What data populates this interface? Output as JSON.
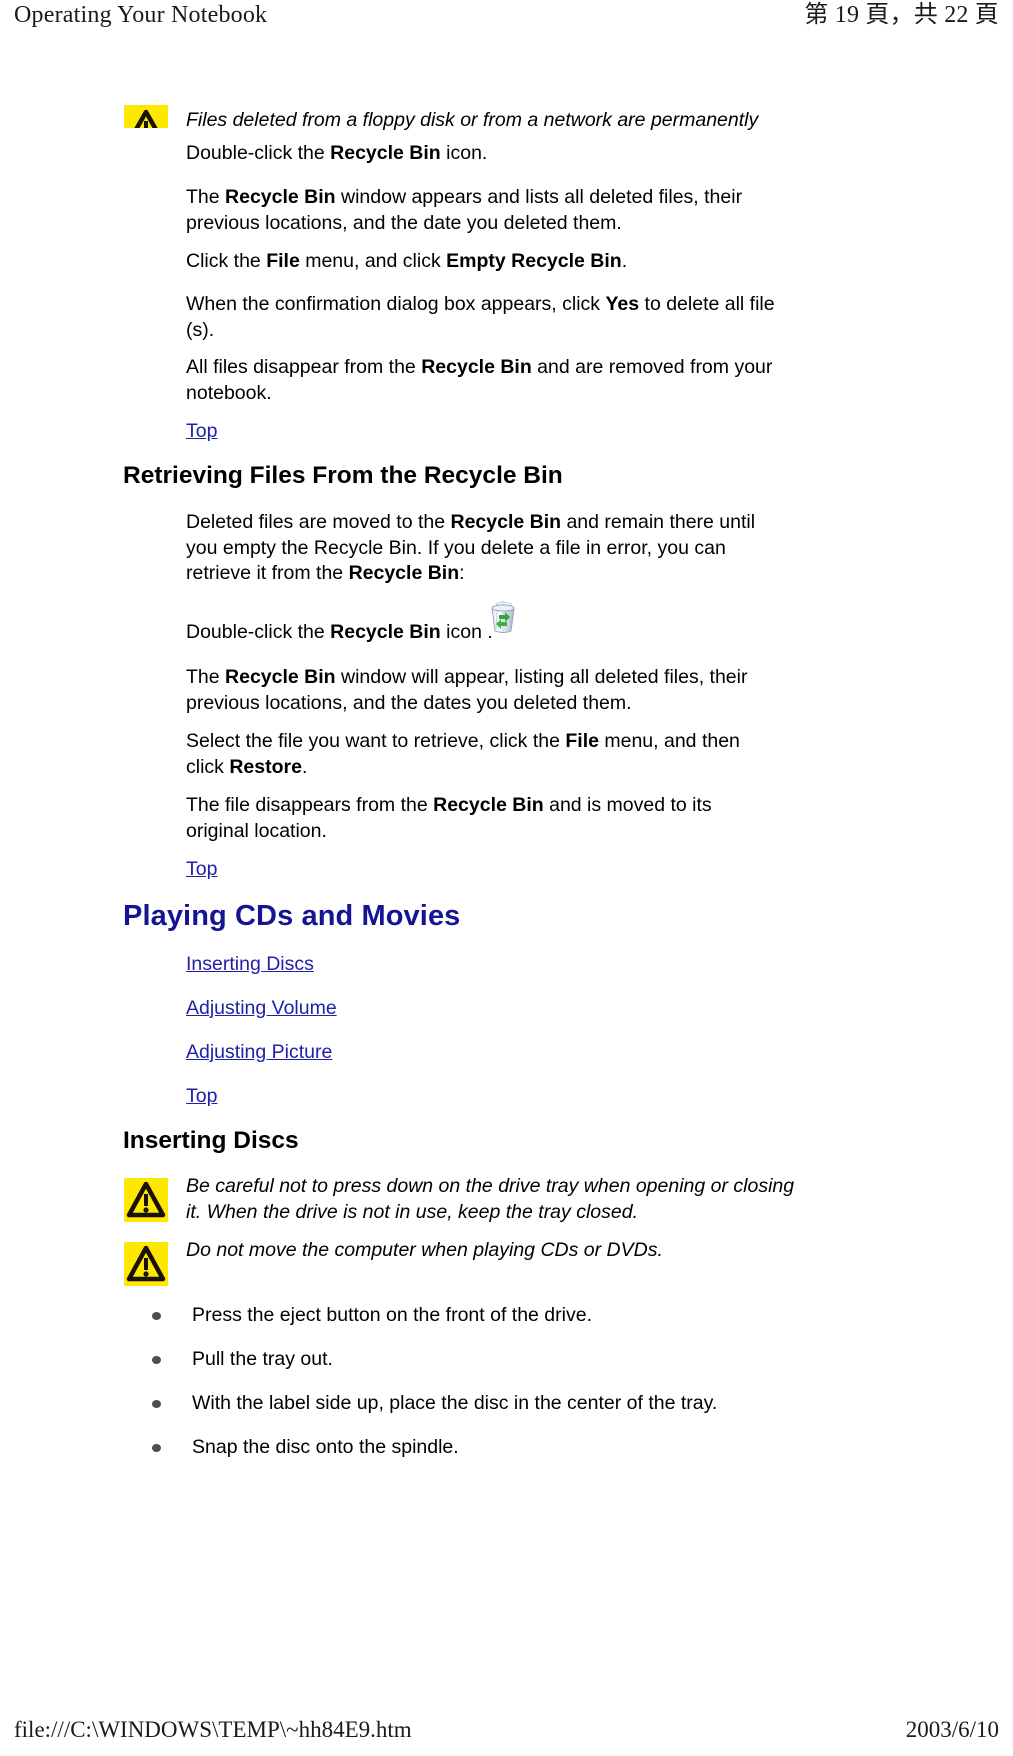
{
  "header": {
    "left_title": "Operating Your Notebook",
    "right_pagination": "第 19 頁，共 22 頁"
  },
  "footer": {
    "file_path": "file:///C:\\WINDOWS\\TEMP\\~hh84E9.htm",
    "date": "2003/6/10"
  },
  "notes": {
    "floppy_note": "Files deleted from a floppy disk or from a network are permanently",
    "tray_caution": "Be careful not to press down on the drive tray when opening or closing it. When the drive is not in use, keep the tray closed.",
    "move_caution": "Do not move the computer when playing CDs or DVDs."
  },
  "empty_recycle_steps": {
    "step1_pre": "Double-click the ",
    "step1_bold": "Recycle Bin",
    "step1_post": " icon.",
    "step2_pre": "The ",
    "step2_bold": "Recycle Bin",
    "step2_post": " window appears and lists all deleted files, their previous locations, and the date you deleted them.",
    "step3_pre": "Click the ",
    "step3_bold1": "File",
    "step3_mid": " menu, and click ",
    "step3_bold2": "Empty Recycle Bin",
    "step3_post": ".",
    "step4_pre": "When the confirmation dialog box appears, click ",
    "step4_bold": "Yes",
    "step4_post": " to delete all file (s).",
    "step5_pre": "All files disappear from the ",
    "step5_bold": "Recycle Bin",
    "step5_post": " and are removed from your notebook."
  },
  "links": {
    "top": "Top",
    "inserting_discs": "Inserting Discs",
    "adjusting_volume": "Adjusting Volume",
    "adjusting_picture": "Adjusting Picture"
  },
  "headings": {
    "retrieving_files": "Retrieving Files From the Recycle Bin",
    "playing_cds": "Playing CDs and Movies",
    "inserting_discs": "Inserting Discs"
  },
  "retrieving_steps": {
    "intro_pre": "Deleted files are moved to the ",
    "intro_bold1": "Recycle Bin",
    "intro_mid": " and remain there until you empty the Recycle Bin. If you delete a file in error, you can retrieve it from the ",
    "intro_bold2": "Recycle Bin",
    "intro_post": ":",
    "step1_pre": "Double-click the ",
    "step1_bold": "Recycle Bin",
    "step1_post": " icon .",
    "step2_pre": "The ",
    "step2_bold": "Recycle Bin",
    "step2_post": " window will appear, listing all deleted files, their previous locations, and the dates you deleted them.",
    "step3_pre": "Select the file you want to retrieve, click the ",
    "step3_bold1": "File",
    "step3_mid": " menu, and then click ",
    "step3_bold2": "Restore",
    "step3_post": ".",
    "step4_pre": "The file disappears from the ",
    "step4_bold": "Recycle Bin",
    "step4_post": " and is moved to its original location."
  },
  "insert_disc_bullets": [
    "Press the eject button on the front of the drive.",
    "Pull the tray out.",
    "With the label side up, place the disc in the center of the tray.",
    "Snap the disc onto the spindle."
  ],
  "icons": {
    "warning_triangle": "warning-triangle-icon",
    "recycle_bin": "recycle-bin-icon"
  },
  "colors": {
    "link": "#2020a8",
    "heading_blue": "#151593",
    "warning_yellow": "#FFE800",
    "text": "#000000"
  }
}
